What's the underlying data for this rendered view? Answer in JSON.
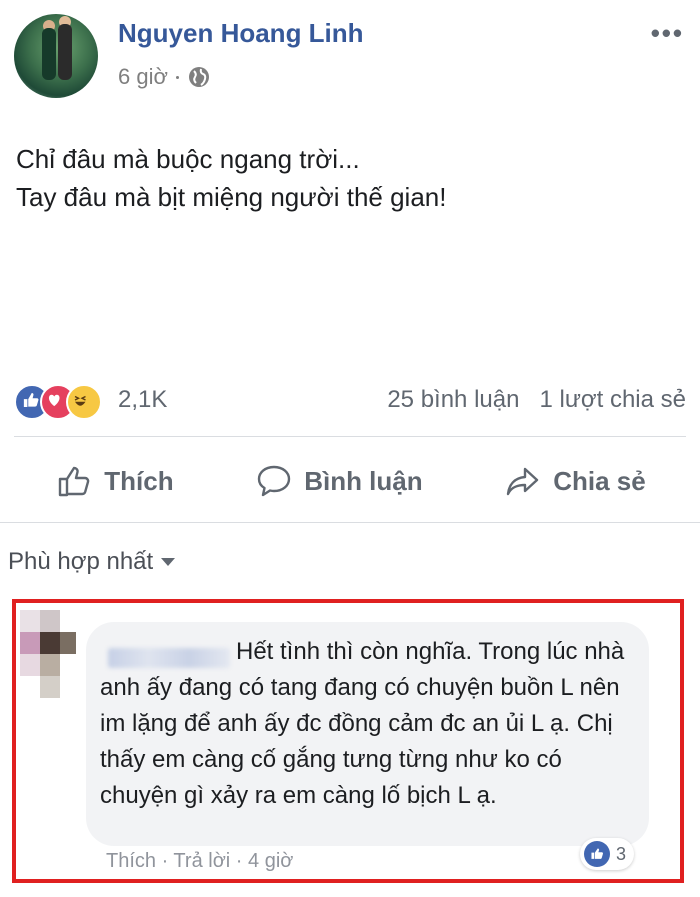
{
  "post": {
    "author": "Nguyen Hoang Linh",
    "time": "6 giờ",
    "text_line1": "Chỉ đâu mà buộc ngang trời...",
    "text_line2": "Tay đâu mà bịt miệng người thế gian!",
    "more_label": "•••"
  },
  "reactions": {
    "count": "2,1K",
    "comments": "25 bình luận",
    "shares": "1 lượt chia sẻ",
    "icons": [
      "like-icon",
      "love-icon",
      "haha-icon"
    ]
  },
  "actions": {
    "like": "Thích",
    "comment": "Bình luận",
    "share": "Chia sẻ"
  },
  "sort_label": "Phù hợp nhất",
  "comment": {
    "text": "Hết tình thì còn nghĩa. Trong lúc nhà anh ấy đang có tang đang có chuyện buồn L nên im lặng để anh ấy đc đồng cảm đc an ủi L ạ. Chị thấy em càng cố gắng tưng từng như ko có chuyện gì xảy ra em càng lố bịch L ạ.",
    "actions": "Thích · Trả lời · 4 giờ",
    "likes": "3"
  },
  "colors": {
    "link_blue": "#365899",
    "like_blue": "#4267b2",
    "highlight_red": "#e02020"
  }
}
